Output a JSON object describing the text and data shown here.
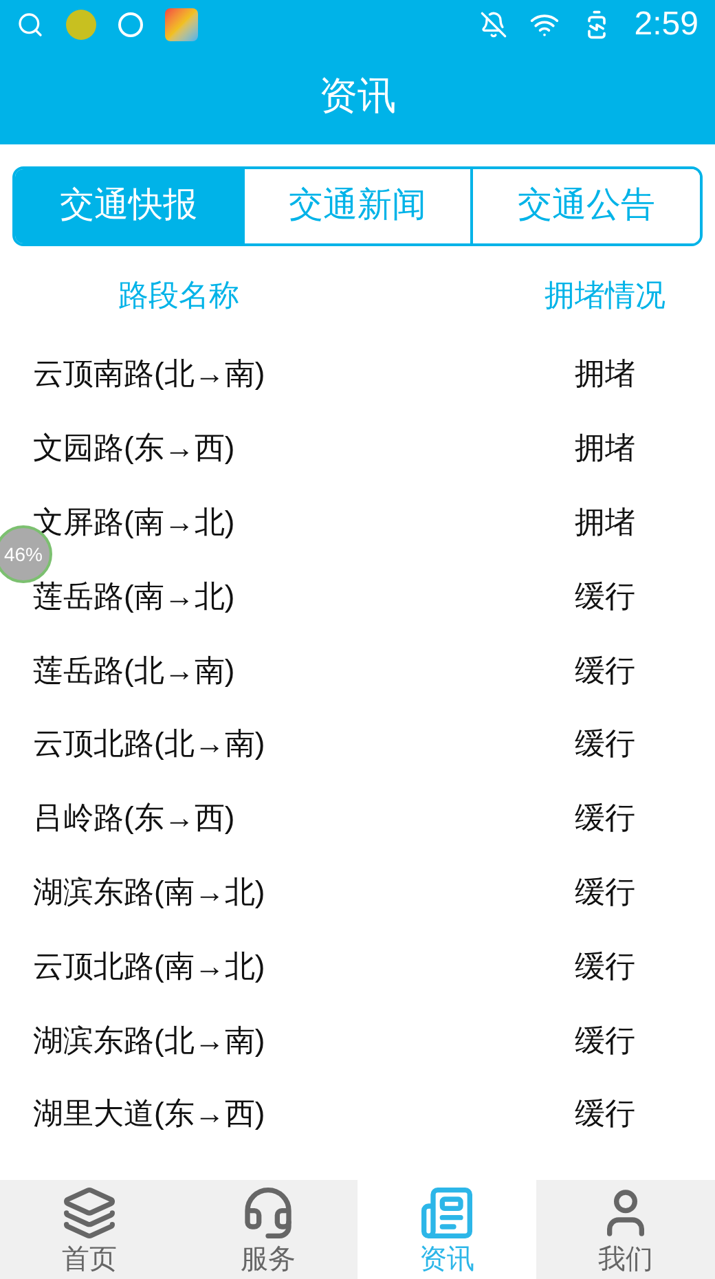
{
  "status_bar": {
    "time": "2:59"
  },
  "header": {
    "title": "资讯"
  },
  "tabs": [
    {
      "label": "交通快报",
      "selected": true
    },
    {
      "label": "交通新闻",
      "selected": false
    },
    {
      "label": "交通公告",
      "selected": false
    }
  ],
  "table": {
    "columns": [
      "路段名称",
      "拥堵情况"
    ],
    "rows": [
      [
        "云顶南路(北→南)",
        "拥堵"
      ],
      [
        "文园路(东→西)",
        "拥堵"
      ],
      [
        "文屏路(南→北)",
        "拥堵"
      ],
      [
        "莲岳路(南→北)",
        "缓行"
      ],
      [
        "莲岳路(北→南)",
        "缓行"
      ],
      [
        "云顶北路(北→南)",
        "缓行"
      ],
      [
        "吕岭路(东→西)",
        "缓行"
      ],
      [
        "湖滨东路(南→北)",
        "缓行"
      ],
      [
        "云顶北路(南→北)",
        "缓行"
      ],
      [
        "湖滨东路(北→南)",
        "缓行"
      ],
      [
        "湖里大道(东→西)",
        "缓行"
      ]
    ]
  },
  "floating_badge": "46%",
  "bottom_nav": [
    {
      "label": "首页",
      "selected": false,
      "kind": "layers"
    },
    {
      "label": "服务",
      "selected": false,
      "kind": "service"
    },
    {
      "label": "资讯",
      "selected": true,
      "kind": "news"
    },
    {
      "label": "我们",
      "selected": false,
      "kind": "user"
    }
  ]
}
